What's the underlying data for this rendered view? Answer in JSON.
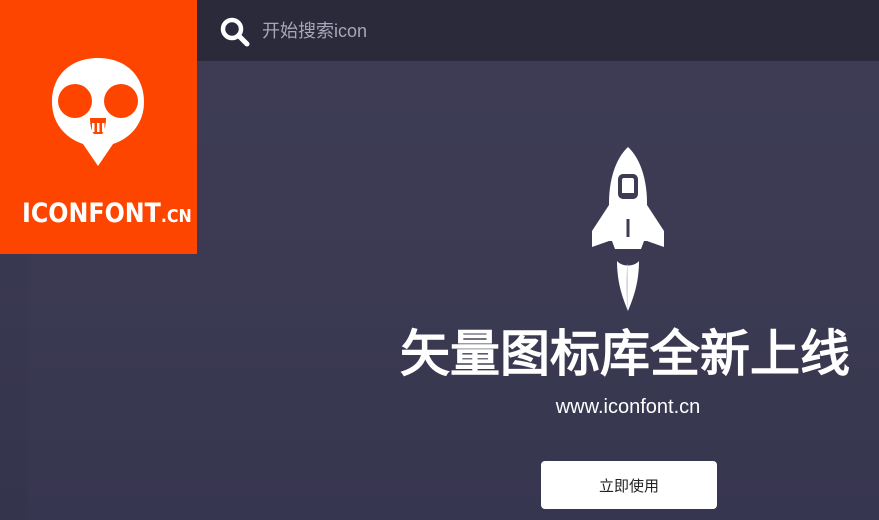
{
  "brand": {
    "logo_text_main": "ICONFONT",
    "logo_text_suffix": ".CN",
    "logo_color": "#fd4500",
    "logo_icon": "skull-icon"
  },
  "search": {
    "placeholder": "开始搜索icon",
    "icon": "search-icon"
  },
  "hero": {
    "icon": "rocket-icon",
    "headline": "矢量图标库全新上线",
    "url": "www.iconfont.cn",
    "cta_label": "立即使用"
  },
  "colors": {
    "topbar": "#2b2a3b",
    "background": "#3d3c54",
    "text": "#ffffff"
  }
}
